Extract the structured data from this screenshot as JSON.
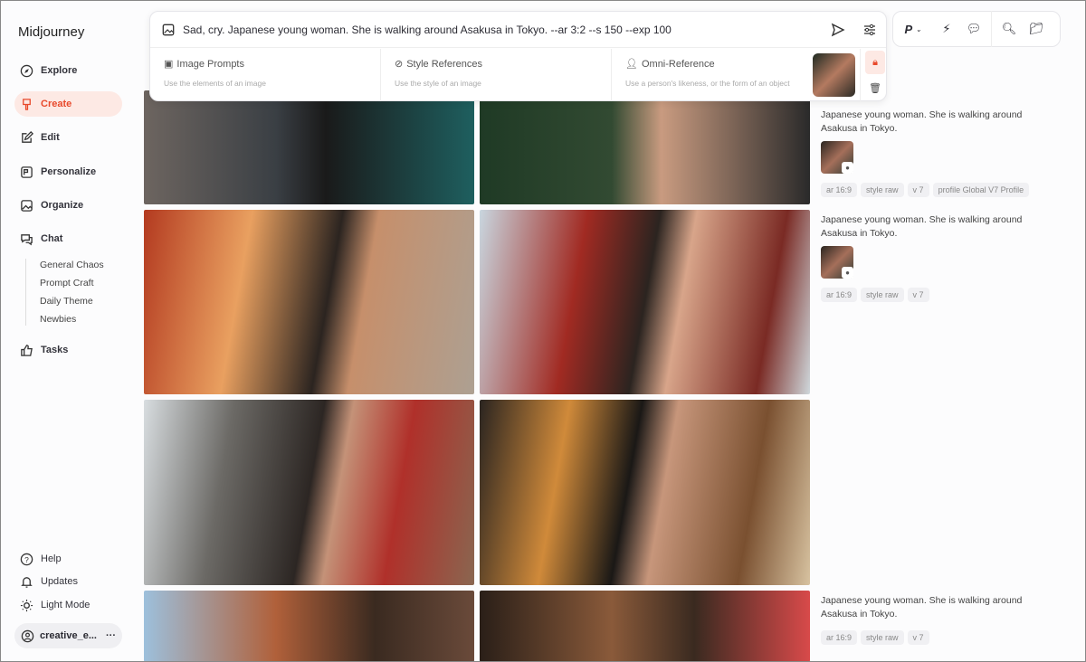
{
  "app": {
    "title": "Midjourney"
  },
  "sidebar": {
    "items": [
      {
        "label": "Explore"
      },
      {
        "label": "Create"
      },
      {
        "label": "Edit"
      },
      {
        "label": "Personalize"
      },
      {
        "label": "Organize"
      },
      {
        "label": "Chat"
      },
      {
        "label": "Tasks"
      }
    ],
    "chat_rooms": [
      "General Chaos",
      "Prompt Craft",
      "Daily Theme",
      "Newbies"
    ],
    "bottom": [
      {
        "label": "Help"
      },
      {
        "label": "Updates"
      },
      {
        "label": "Light Mode"
      }
    ],
    "user": {
      "name": "creative_e...",
      "more": "···"
    }
  },
  "prompt": {
    "value": "Sad, cry. Japanese young woman. She is walking around Asakusa in Tokyo. --ar 3:2 --s 150 --exp 100",
    "refs": [
      {
        "title": "Image Prompts",
        "desc": "Use the elements of an image"
      },
      {
        "title": "Style References",
        "desc": "Use the style of an image"
      },
      {
        "title": "Omni-Reference",
        "desc": "Use a person's likeness, or the form of an object"
      }
    ]
  },
  "toolbar": {
    "profile": "P"
  },
  "accent": "#e8492b",
  "jobs": [
    {
      "desc": "Japanese young woman. She is walking around Asakusa in Tokyo.",
      "tags": [
        "ar 16:9",
        "style raw",
        "v 7",
        "profile Global V7 Profile"
      ]
    },
    {
      "desc": "Japanese young woman. She is walking around Asakusa in Tokyo.",
      "tags": [
        "ar 16:9",
        "style raw",
        "v 7"
      ]
    },
    {
      "desc": "Japanese young woman. She is walking around Asakusa in Tokyo.",
      "tags": [
        "ar 16:9",
        "style raw",
        "v 7"
      ]
    }
  ]
}
